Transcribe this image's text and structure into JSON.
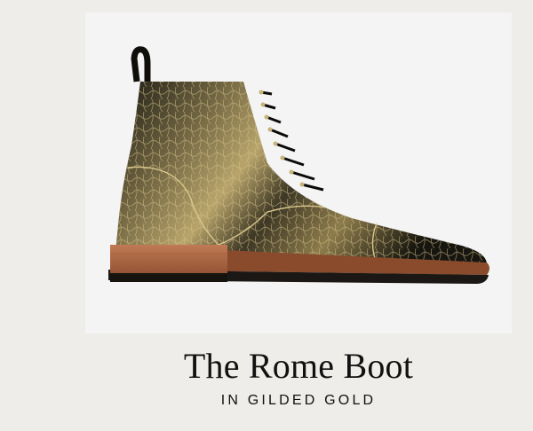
{
  "product": {
    "name": "The Rome Boot",
    "variant": "IN GILDED GOLD",
    "image_subject": "boot-image"
  },
  "colors": {
    "page_background": "#eeede9",
    "photo_background": "#f4f4f4",
    "leather_dark": "#1b1a14",
    "leather_gold": "#b9a266",
    "sole_brown": "#8a4b2c"
  }
}
